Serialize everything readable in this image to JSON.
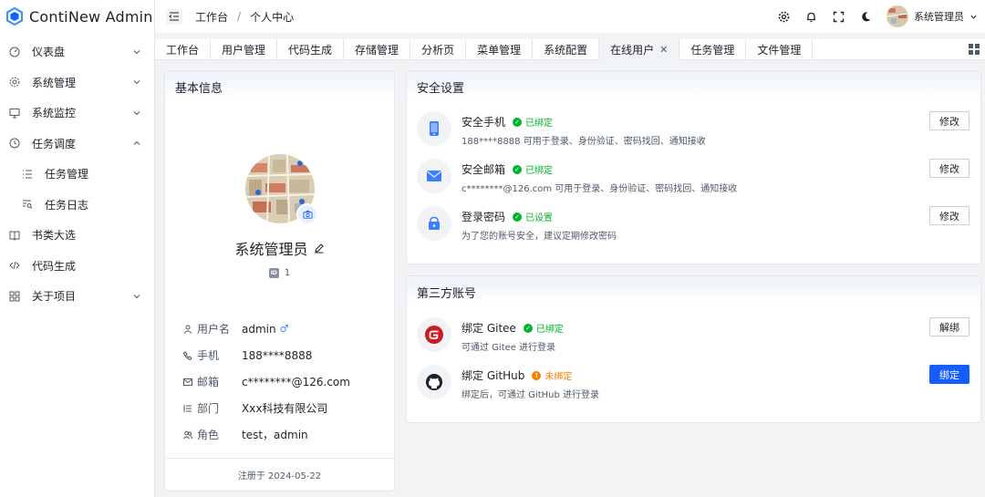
{
  "app": {
    "title": "ContiNew Admin"
  },
  "sidebar": {
    "items": [
      {
        "label": "仪表盘"
      },
      {
        "label": "系统管理"
      },
      {
        "label": "系统监控"
      },
      {
        "label": "任务调度"
      },
      {
        "label": "任务管理"
      },
      {
        "label": "任务日志"
      },
      {
        "label": "书类大选"
      },
      {
        "label": "代码生成"
      },
      {
        "label": "关于项目"
      }
    ]
  },
  "header": {
    "breadcrumb": [
      "工作台",
      "个人中心"
    ],
    "breadcrumb_sep": "/",
    "username": "系统管理员"
  },
  "tabs": [
    {
      "label": "工作台"
    },
    {
      "label": "用户管理"
    },
    {
      "label": "代码生成"
    },
    {
      "label": "存储管理"
    },
    {
      "label": "分析页"
    },
    {
      "label": "菜单管理"
    },
    {
      "label": "系统配置"
    },
    {
      "label": "在线用户",
      "active": true,
      "close": "✕"
    },
    {
      "label": "任务管理"
    },
    {
      "label": "文件管理"
    }
  ],
  "basic": {
    "title": "基本信息",
    "nickname": "系统管理员",
    "id": "1",
    "id_chip": "ID",
    "fields": [
      {
        "key": "用户名",
        "value": "admin",
        "gender": "♂"
      },
      {
        "key": "手机",
        "value": "188****8888"
      },
      {
        "key": "邮箱",
        "value": "c********@126.com"
      },
      {
        "key": "部门",
        "value": "Xxx科技有限公司"
      },
      {
        "key": "角色",
        "value": "test，admin"
      }
    ],
    "footer": "注册于 2024-05-22"
  },
  "security": {
    "title": "安全设置",
    "items": [
      {
        "title": "安全手机",
        "status": "已绑定",
        "desc": "188****8888 可用于登录、身份验证、密码找回、通知接收",
        "button": "修改"
      },
      {
        "title": "安全邮箱",
        "status": "已绑定",
        "desc": "c********@126.com 可用于登录、身份验证、密码找回、通知接收",
        "button": "修改"
      },
      {
        "title": "登录密码",
        "status": "已设置",
        "desc": "为了您的账号安全，建议定期修改密码",
        "button": "修改"
      }
    ]
  },
  "third": {
    "title": "第三方账号",
    "items": [
      {
        "title": "绑定 Gitee",
        "status": "已绑定",
        "desc": "可通过 Gitee 进行登录",
        "button": "解绑"
      },
      {
        "title": "绑定 GitHub",
        "status": "未绑定",
        "desc": "绑定后，可通过 GitHub 进行登录",
        "button": "绑定"
      }
    ]
  },
  "colors": {
    "primary": "#165dff",
    "success": "#00b42a",
    "warning": "#ff7d00"
  }
}
